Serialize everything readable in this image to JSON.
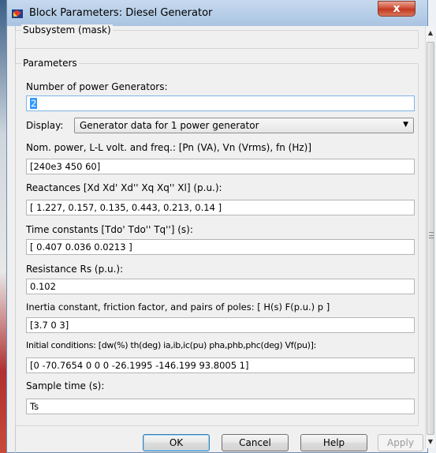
{
  "window": {
    "title": "Block Parameters: Diesel Generator",
    "close_glyph": "x"
  },
  "subsystem_group": {
    "legend": "Subsystem (mask)"
  },
  "parameters_group": {
    "legend": "Parameters"
  },
  "fields": {
    "num_generators": {
      "label": "Number of power Generators:",
      "value": "2"
    },
    "display": {
      "label": "Display:",
      "value": "Generator data for 1 power generator"
    },
    "nominal": {
      "label": "Nom. power, L-L volt. and freq.: [Pn (VA), Vn (Vrms), fn (Hz)]",
      "value": "[240e3 450 60]"
    },
    "reactances": {
      "label": "Reactances [Xd Xd' Xd'' Xq Xq'' Xl] (p.u.):",
      "value": "[ 1.227, 0.157, 0.135, 0.443,  0.213,  0.14 ]"
    },
    "time_constants": {
      "label": "Time constants [Tdo' Tdo'' Tq''] (s):",
      "value": "[  0.407  0.036  0.0213  ]"
    },
    "resistance": {
      "label": "Resistance Rs (p.u.):",
      "value": "0.102"
    },
    "inertia": {
      "label": "Inertia constant, friction factor, and pairs of poles: [ H(s)  F(p.u.)  p ]",
      "value": "[3.7 0 3]"
    },
    "initial_conditions": {
      "label": "Initial conditions: [dw(%) th(deg) ia,ib,ic(pu) pha,phb,phc(deg) Vf(pu)]:",
      "value": "[0 -70.7654 0 0 0 -26.1995 -146.199 93.8005 1]"
    },
    "sample_time": {
      "label": "Sample time (s):",
      "value": "Ts"
    }
  },
  "buttons": {
    "ok": "OK",
    "cancel": "Cancel",
    "help": "Help",
    "apply": "Apply"
  },
  "icons": {
    "app": "simulink-block-icon",
    "dropdown": "chevron-down-icon"
  },
  "colors": {
    "titlebar": "#b8cfe8",
    "close": "#c9432b",
    "selection": "#3399ff",
    "dialog": "#f0f0f0"
  }
}
